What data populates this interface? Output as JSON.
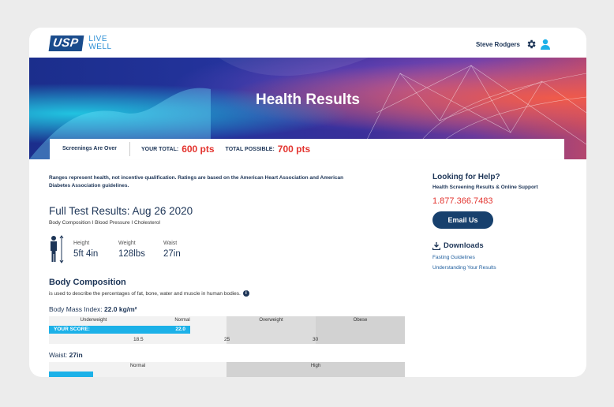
{
  "header": {
    "logo_text": "USP",
    "logo_words": [
      "LIVE",
      "WELL"
    ],
    "user_name": "Steve Rodgers",
    "icons": {
      "settings": "gear-icon",
      "profile": "person-icon"
    }
  },
  "hero": {
    "title": "Health Results"
  },
  "scorebar": {
    "status": "Screenings Are Over",
    "your_total_label": "YOUR TOTAL:",
    "your_total_value": "600 pts",
    "total_possible_label": "TOTAL POSSIBLE:",
    "total_possible_value": "700 pts"
  },
  "main": {
    "intro": "Ranges represent health, not incentive qualification. Ratings are based on the American Heart Association and American Diabetes Association guidelines.",
    "test_title": "Full Test Results: Aug 26 2020",
    "test_sub": "Body Composition   I   Blood Pressure   I   Cholesterol",
    "measurements": [
      {
        "label": "Height",
        "value": "5ft 4in"
      },
      {
        "label": "Weight",
        "value": "128lbs"
      },
      {
        "label": "Waist",
        "value": "27in"
      }
    ],
    "body_comp": {
      "title": "Body Composition",
      "description": "is used to describe the percentages of fat, bone, water and muscle in human bodies.",
      "bmi_label": "Body Mass Index:",
      "bmi_value": "22.0 kg/m²",
      "bmi_categories": [
        "Underweight",
        "Normal",
        "Overweight",
        "Obese"
      ],
      "your_score_label": "YOUR SCORE:",
      "your_score_value": "22.0",
      "your_score_fraction": 0.398,
      "ticks": [
        "18.5",
        "25",
        "30"
      ],
      "waist_label": "Waist:",
      "waist_value": "27in",
      "waist_categories": [
        "Normal",
        "High"
      ],
      "waist_fraction": 0.124
    }
  },
  "sidebar": {
    "help_title": "Looking for Help?",
    "help_sub": "Health Screening Results & Online Support",
    "phone": "1.877.366.7483",
    "email_button": "Email Us",
    "downloads_title": "Downloads",
    "links": [
      "Fasting Guidelines",
      "Understanding Your Results"
    ]
  },
  "colors": {
    "navy": "#1d3557",
    "accent_red": "#e3342f",
    "score_blue": "#1cb1e8",
    "button": "#17406d"
  }
}
